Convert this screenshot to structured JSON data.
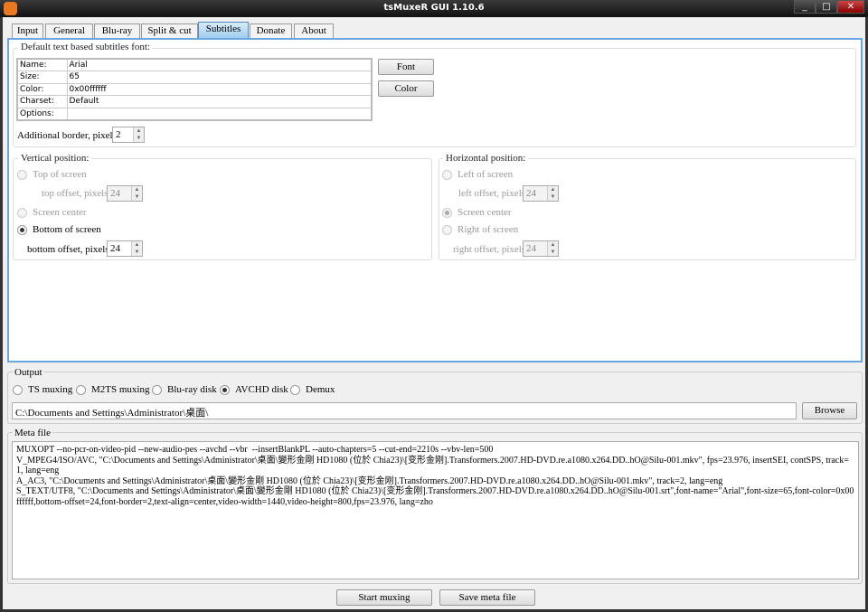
{
  "window": {
    "title": "tsMuxeR GUI 1.10.6",
    "controls": [
      "_",
      "□",
      "✕"
    ]
  },
  "tabs": [
    {
      "label": "Input"
    },
    {
      "label": "General"
    },
    {
      "label": "Blu-ray"
    },
    {
      "label": "Split & cut"
    },
    {
      "label": "Subtitles",
      "active": true
    },
    {
      "label": "Donate"
    },
    {
      "label": "About"
    }
  ],
  "font_group": {
    "label": "Default text based subtitles font:",
    "rows": [
      {
        "k": "Name:",
        "v": "Arial"
      },
      {
        "k": "Size:",
        "v": "65"
      },
      {
        "k": "Color:",
        "v": "0x00ffffff"
      },
      {
        "k": "Charset:",
        "v": "Default"
      },
      {
        "k": "Options:",
        "v": ""
      }
    ],
    "font_button": "Font",
    "color_button": "Color",
    "border_label": "Additional border, pixels:",
    "border_value": "2"
  },
  "vertical": {
    "label": "Vertical position:",
    "top": "Top of screen",
    "top_offset_label": "top offset, pixels:",
    "top_offset": "24",
    "center": "Screen center",
    "bottom": "Bottom of screen",
    "bottom_offset_label": "bottom offset, pixels:",
    "bottom_offset": "24",
    "selected": "bottom"
  },
  "horizontal": {
    "label": "Horizontal position:",
    "left": "Left of screen",
    "left_offset_label": "left offset, pixels:",
    "left_offset": "24",
    "center": "Screen center",
    "right": "Right of screen",
    "right_offset_label": "right offset, pixels:",
    "right_offset": "24",
    "selected": "center"
  },
  "output": {
    "label": "Output",
    "options": [
      "TS muxing",
      "M2TS muxing",
      "Blu-ray disk",
      "AVCHD disk",
      "Demux"
    ],
    "selected": "AVCHD disk",
    "path": "C:\\Documents and Settings\\Administrator\\桌面\\",
    "browse": "Browse"
  },
  "meta": {
    "label": "Meta file",
    "text": "MUXOPT --no-pcr-on-video-pid --new-audio-pes --avchd --vbr  --insertBlankPL --auto-chapters=5 --cut-end=2210s --vbv-len=500\nV_MPEG4/ISO/AVC, \"C:\\Documents and Settings\\Administrator\\桌面\\變形金剛 HD1080 (位於 Chia23)\\[变形金刚].Transformers.2007.HD-DVD.re.a1080.x264.DD..hO@Silu-001.mkv\", fps=23.976, insertSEI, contSPS, track=1, lang=eng\nA_AC3, \"C:\\Documents and Settings\\Administrator\\桌面\\變形金剛 HD1080 (位於 Chia23)\\[变形金刚].Transformers.2007.HD-DVD.re.a1080.x264.DD..hO@Silu-001.mkv\", track=2, lang=eng\nS_TEXT/UTF8, \"C:\\Documents and Settings\\Administrator\\桌面\\變形金剛 HD1080 (位於 Chia23)\\[变形金刚].Transformers.2007.HD-DVD.re.a1080.x264.DD..hO@Silu-001.srt\",font-name=\"Arial\",font-size=65,font-color=0x00ffffff,bottom-offset=24,font-border=2,text-align=center,video-width=1440,video-height=800,fps=23.976, lang=zho"
  },
  "actions": {
    "start": "Start muxing",
    "save": "Save meta file"
  }
}
